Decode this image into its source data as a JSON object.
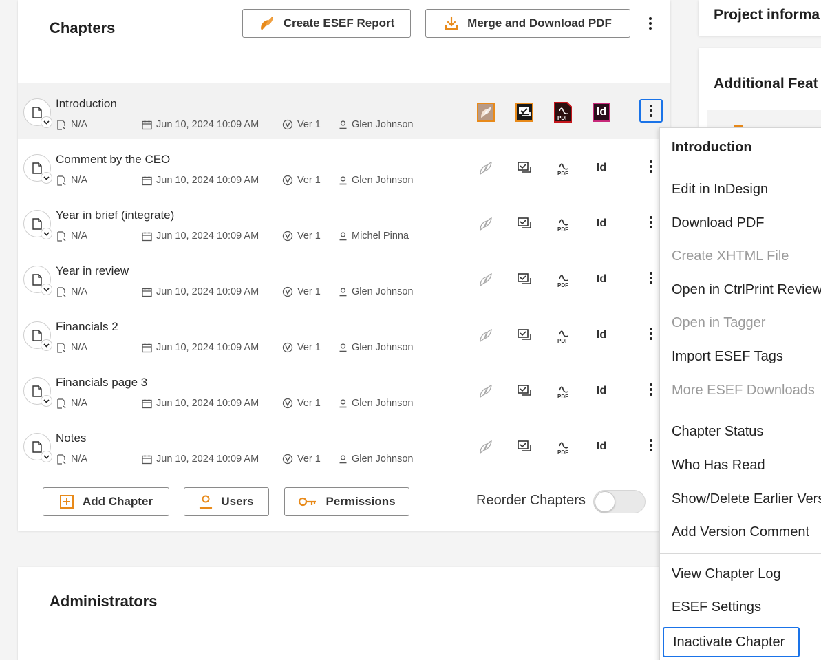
{
  "chapters": {
    "title": "Chapters",
    "create_esef_label": "Create ESEF Report",
    "merge_pdf_label": "Merge and Download PDF",
    "rows": [
      {
        "title": "Introduction",
        "status": "N/A",
        "date": "Jun 10, 2024 10:09 AM",
        "version": "Ver 1",
        "user": "Glen Johnson"
      },
      {
        "title": "Comment by the CEO",
        "status": "N/A",
        "date": "Jun 10, 2024 10:09 AM",
        "version": "Ver 1",
        "user": "Glen Johnson"
      },
      {
        "title": "Year in brief (integrate)",
        "status": "N/A",
        "date": "Jun 10, 2024 10:09 AM",
        "version": "Ver 1",
        "user": "Michel Pinna"
      },
      {
        "title": "Year in review",
        "status": "N/A",
        "date": "Jun 10, 2024 10:09 AM",
        "version": "Ver 1",
        "user": "Glen Johnson"
      },
      {
        "title": "Financials 2",
        "status": "N/A",
        "date": "Jun 10, 2024 10:09 AM",
        "version": "Ver 1",
        "user": "Glen Johnson"
      },
      {
        "title": "Financials page 3",
        "status": "N/A",
        "date": "Jun 10, 2024 10:09 AM",
        "version": "Ver 1",
        "user": "Glen Johnson"
      },
      {
        "title": "Notes",
        "status": "N/A",
        "date": "Jun 10, 2024 10:09 AM",
        "version": "Ver 1",
        "user": "Glen Johnson"
      }
    ],
    "id_label": "Id",
    "pdf_label": "PDF",
    "add_chapter_label": "Add Chapter",
    "users_label": "Users",
    "permissions_label": "Permissions",
    "reorder_label": "Reorder Chapters"
  },
  "admins": {
    "title": "Administrators"
  },
  "side": {
    "project_title": "Project informa",
    "features_title": "Additional Feat"
  },
  "menu": {
    "header": "Introduction",
    "items": [
      "Edit in InDesign",
      "Download PDF",
      "Create XHTML File",
      "Open in CtrlPrint Review",
      "Open in Tagger",
      "Import ESEF Tags",
      "More ESEF Downloads",
      "Chapter Status",
      "Who Has Read",
      "Show/Delete Earlier Vers",
      "Add Version Comment",
      "View Chapter Log",
      "ESEF Settings",
      "Inactivate Chapter"
    ]
  },
  "colors": {
    "accent": "#e88a1a",
    "focus": "#1a73e8",
    "pdf_red": "#c4161c",
    "indesign_pink": "#c8297a"
  }
}
